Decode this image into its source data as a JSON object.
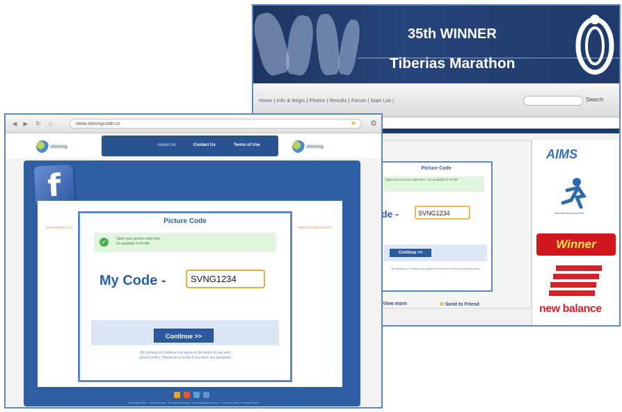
{
  "back_window": {
    "banner": {
      "title_line1": "35th WINNER",
      "title_line2": "Tiberias Marathon"
    },
    "nav": {
      "text": "Home | Info & Regis | Photos | Results | Forum | Start List |",
      "search_label": "Search"
    },
    "modal": {
      "heading": "Picture Code",
      "message": "Open your picture code here - It's available in Profile",
      "code_label": "de -",
      "code_value": "SVNG1234",
      "button_label": "Continue >>",
      "footer": "By clicking on Continue you agree to the terms of use and privacy policy"
    },
    "share": {
      "view_more": "View more",
      "send": "Send to Friend"
    },
    "sponsors": {
      "aims": "AIMS",
      "sponsor_caption": "international association",
      "winner": "Winner",
      "new_balance": "new balance"
    },
    "colors": {
      "banner": "#1d3460",
      "accent": "#5d86c4",
      "winner_red": "#d01820",
      "nb_red": "#d3232a"
    }
  },
  "front_window": {
    "browser": {
      "url": "www.shiningcode.co",
      "icons": [
        "back-icon",
        "forward-icon",
        "reload-icon",
        "home-icon",
        "star-icon",
        "gear-icon"
      ]
    },
    "header": {
      "logo_text": "shining",
      "nav_item_1": "About Us",
      "nav_item_2": "Contact Us",
      "nav_item_3": "Terms of Use"
    },
    "side_texts": {
      "left": "www.shining.co.il",
      "right": "www.shiningcode.co.il"
    },
    "modal": {
      "heading": "Picture Code",
      "message_line1": "Open your picture code here",
      "message_line2": "It's available in Profile",
      "code_label": "My Code -",
      "code_value": "SVNG1234",
      "button_label": "Continue >>",
      "footer_line1": "By clicking on Continue you agree to the terms of use and",
      "footer_line2": "privacy policy. Please let us know if you have any questions"
    },
    "footer": "Copyright 2012 - ShiningCode - All rights reserved - www.shiningcode.co.il - Terms of Use - Privacy Policy",
    "colors": {
      "brand_blue": "#2f5ea2",
      "input_border": "#e5ae44",
      "success_bg": "#e2f6df"
    }
  }
}
